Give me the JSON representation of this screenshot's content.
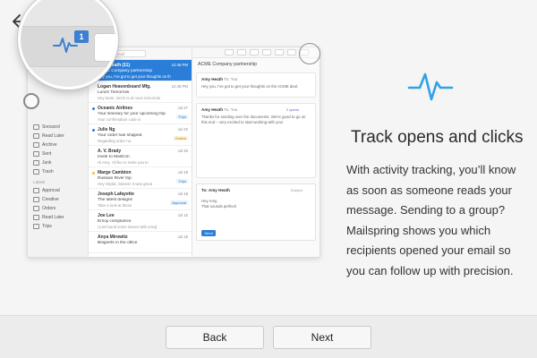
{
  "title": "Track opens and clicks",
  "description": "With activity tracking, you’ll know as soon as someone reads your message. Sending to a group? Mailspring shows you which recipients opened your email so you can follow up with precision.",
  "buttons": {
    "back": "Back",
    "next": "Next"
  },
  "accent_color": "#2fa3e6",
  "icons": {
    "back": "arrow-left-icon",
    "hero": "activity-pulse-icon"
  },
  "mockup": {
    "badge_count": "1",
    "search_placeholder": "Search all email",
    "sidebar": {
      "items": [
        "Snoozed",
        "Read Later",
        "Archive",
        "Sent",
        "Junk",
        "Trash"
      ],
      "labels_heading": "Labels",
      "labels": [
        "Approval",
        "Creative",
        "Orders",
        "Read Later",
        "Trips"
      ]
    },
    "messages": [
      {
        "from": "Amy Heath (11)",
        "subject": "ACME Company partnership",
        "preview": "Hey you, I've got to get your thoughts on th",
        "date": "12:45 PM"
      },
      {
        "from": "Logan Heavenboard Mfg.",
        "subject": "Lunch Tomorrow",
        "preview": "Hey team, lunch is at noon tomorrow",
        "date": "12:45 PM"
      },
      {
        "from": "Oceanic Airlines",
        "subject": "Your itinerary for your upcoming trip",
        "preview": "Your confirmation code is",
        "date": "Jul 27",
        "tag": "Trips"
      },
      {
        "from": "Julie Ng",
        "subject": "Your order has shipped",
        "preview": "Regarding order no.",
        "date": "Jul 22",
        "tag": "Orders"
      },
      {
        "from": "A. V. Brady",
        "subject": "Invite to MailCon",
        "preview": "Hi Amy, I'd like to invite you to",
        "date": "Jul 20"
      },
      {
        "from": "Marge Cambion",
        "subject": "Russian River trip",
        "preview": "Hey Skylar, Steven! It was great",
        "date": "Jul 19",
        "tag": "Trips"
      },
      {
        "from": "Joseph Lafayette",
        "subject": "The latest designs",
        "preview": "Take a look at these",
        "date": "Jul 18",
        "tag": "Approval"
      },
      {
        "from": "Joe Lee",
        "subject": "Emoji compliance",
        "preview": "I just found some issues with emoji",
        "date": "Jul 16"
      },
      {
        "from": "Anya Mirowitz",
        "subject": "Beignets in the office",
        "preview": "",
        "date": "Jul 15"
      }
    ],
    "thread_subject": "ACME Company partnership",
    "thread_messages": [
      {
        "from": "Amy Heath",
        "to": "To: You",
        "body": "Hey you, I've got to get your thoughts on the ACME deal."
      },
      {
        "from": "Amy Heath",
        "to": "To: You",
        "body": "Thanks for sending over the documents. We're good to go on this end – very excited to start working with you!",
        "chip": "2 opens"
      }
    ],
    "compose": {
      "to": "To: Amy Heath",
      "subject_label": "Subject",
      "body_line1": "Hey Amy,",
      "body_line2": "That sounds perfect!",
      "send": "Send"
    }
  }
}
